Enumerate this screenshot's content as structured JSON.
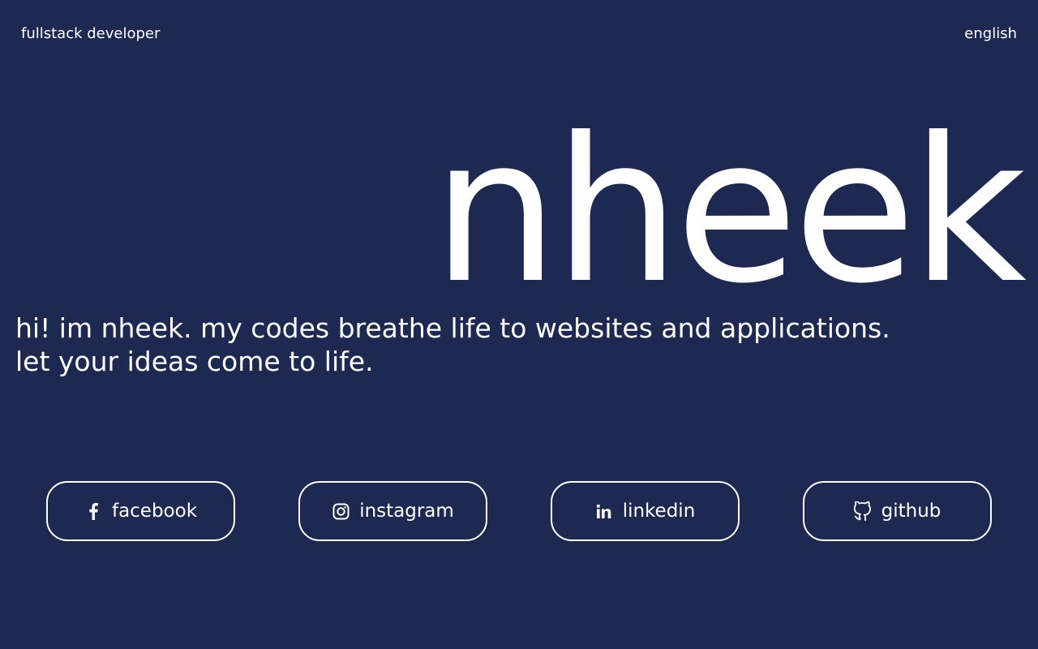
{
  "header": {
    "role": "fullstack developer",
    "language": "english"
  },
  "hero": {
    "name": "nheek",
    "tagline_line1": "hi! im nheek. my codes breathe life to websites and applications.",
    "tagline_line2": "let your ideas come to life."
  },
  "socials": [
    {
      "label": "facebook",
      "icon": "facebook-icon"
    },
    {
      "label": "instagram",
      "icon": "instagram-icon"
    },
    {
      "label": "linkedin",
      "icon": "linkedin-icon"
    },
    {
      "label": "github",
      "icon": "github-icon"
    }
  ],
  "colors": {
    "background": "#1e2952",
    "text": "#ffffff"
  }
}
